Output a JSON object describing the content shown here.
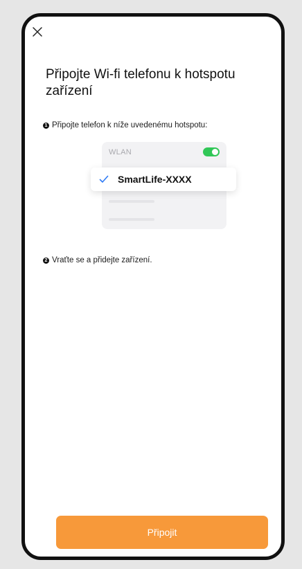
{
  "header": {
    "close_icon": "close-icon",
    "title": "Připojte Wi-fi telefonu k hotspotu zařízení"
  },
  "steps": [
    {
      "number": "1",
      "text": "Připojte telefon k níže uvedenému hotspotu:"
    },
    {
      "number": "2",
      "text": "Vraťte se a přidejte zařízení."
    }
  ],
  "wifi_illustration": {
    "wlan_label": "WLAN",
    "toggle_on": true,
    "selected_network": "SmartLife-XXXX",
    "check_icon": "checkmark-icon"
  },
  "footer": {
    "connect_label": "Připojit"
  },
  "colors": {
    "accent": "#f7993a",
    "toggle": "#31c757",
    "checkmark": "#2f7bf5",
    "frame": "#111111",
    "background": "#e6e6e6"
  }
}
